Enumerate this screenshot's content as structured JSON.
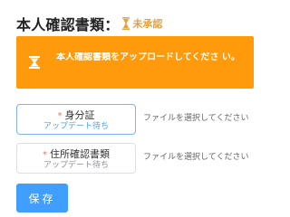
{
  "header": {
    "title": "本人確認書類：",
    "status": "未承認",
    "status_icon": "hourglass-icon",
    "status_color": "#e6a23c"
  },
  "banner": {
    "icon": "hourglass-icon",
    "message": "本人確認書類をアップロードしてくださ い。",
    "background": "#ff9a0d"
  },
  "documents": [
    {
      "required_mark": "*",
      "label": "身分証",
      "sub": "アップデート待ち",
      "file_placeholder": "ファイルを選択してください"
    },
    {
      "required_mark": "*",
      "label": "住所確認書類",
      "sub": "アップデート待ち",
      "file_placeholder": "ファイルを選択してください"
    }
  ],
  "save_button": {
    "label": "保存",
    "color": "#409eff"
  }
}
